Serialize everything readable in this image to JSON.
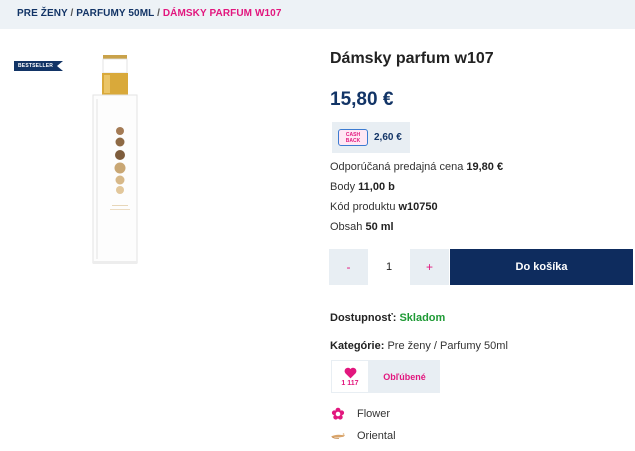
{
  "breadcrumb": {
    "items": [
      "PRE ŽENY",
      "PARFUMY 50ML",
      "DÁMSKY PARFUM W107"
    ],
    "separator": "/"
  },
  "badge": {
    "label": "BESTSELLER"
  },
  "product": {
    "title": "Dámsky parfum w107",
    "price": "15,80 €",
    "cashback": {
      "icon_line1": "CASH",
      "icon_line2": "BACK",
      "value": "2,60 €"
    },
    "details": [
      {
        "label": "Odporúčaná predajná cena",
        "value": "19,80 €"
      },
      {
        "label": "Body",
        "value": "11,00 b"
      },
      {
        "label": "Kód produktu",
        "value": "w10750"
      },
      {
        "label": "Obsah",
        "value": "50 ml"
      }
    ],
    "quantity": {
      "minus": "-",
      "value": "1",
      "plus": "+"
    },
    "cart_button": "Do košíka",
    "availability": {
      "label": "Dostupnosť:",
      "value": "Skladom"
    },
    "category": {
      "label": "Kategórie:",
      "value": "Pre ženy / Parfumy 50ml"
    },
    "favorites": {
      "count": "1 117",
      "label": "Obľúbené"
    },
    "notes": [
      {
        "icon": "flower-icon",
        "label": "Flower"
      },
      {
        "icon": "oriental-icon",
        "label": "Oriental"
      }
    ]
  },
  "colors": {
    "navy": "#123466",
    "pink": "#e2177e",
    "green": "#1e9a35",
    "light_panel": "#e8eef3"
  }
}
